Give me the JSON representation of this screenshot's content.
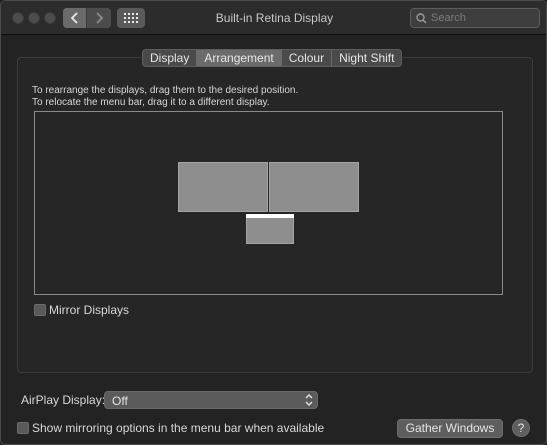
{
  "window": {
    "title": "Built-in Retina Display"
  },
  "toolbar": {
    "search_placeholder": "Search"
  },
  "tabs": [
    {
      "label": "Display",
      "selected": false
    },
    {
      "label": "Arrangement",
      "selected": true
    },
    {
      "label": "Colour",
      "selected": false
    },
    {
      "label": "Night Shift",
      "selected": false
    }
  ],
  "arrangement": {
    "instruction_line_1": "To rearrange the displays, drag them to the desired position.",
    "instruction_line_2": "To relocate the menu bar, drag it to a different display.",
    "mirror_displays_label": "Mirror Displays",
    "mirror_displays_checked": false
  },
  "airplay": {
    "label": "AirPlay Display:",
    "value": "Off"
  },
  "menu_bar_option": {
    "label": "Show mirroring options in the menu bar when available",
    "checked": false
  },
  "buttons": {
    "gather_windows": "Gather Windows",
    "help": "?"
  },
  "colors": {
    "accent": "#5a5a5a",
    "display_fill": "#8e8e8e",
    "menu_bar": "#ffffff"
  },
  "icons": {
    "close": "traffic-light-close",
    "minimize": "traffic-light-minimize",
    "zoom": "traffic-light-zoom",
    "back": "chevron-left",
    "forward": "chevron-right",
    "show_all": "grid-dots",
    "search": "magnifying-glass"
  }
}
